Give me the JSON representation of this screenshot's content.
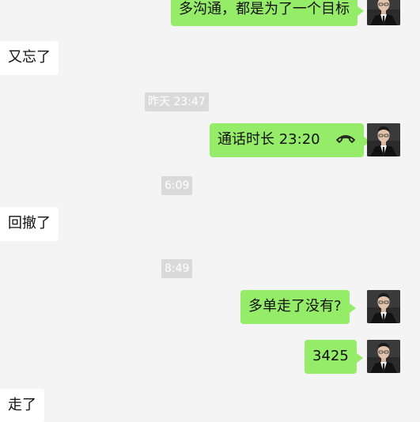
{
  "messages": [
    {
      "side": "out",
      "text": "多沟通，都是为了一个目标"
    },
    {
      "side": "in",
      "text": "又忘了"
    },
    {
      "type": "timestamp",
      "text": "昨天 23:47"
    },
    {
      "side": "out",
      "text": "通话时长 23:20",
      "icon": "phone-hangup-icon"
    },
    {
      "type": "timestamp",
      "text": "6:09"
    },
    {
      "side": "in",
      "text": "回撤了"
    },
    {
      "type": "timestamp",
      "text": "8:49"
    },
    {
      "side": "out",
      "text": "多单走了没有?"
    },
    {
      "side": "out",
      "text": "3425"
    },
    {
      "side": "in",
      "text": "走了"
    }
  ],
  "colors": {
    "background": "#f4f4f4",
    "outgoing_bubble": "#95ec69",
    "incoming_bubble": "#ffffff",
    "timestamp_bg": "#dadada"
  }
}
